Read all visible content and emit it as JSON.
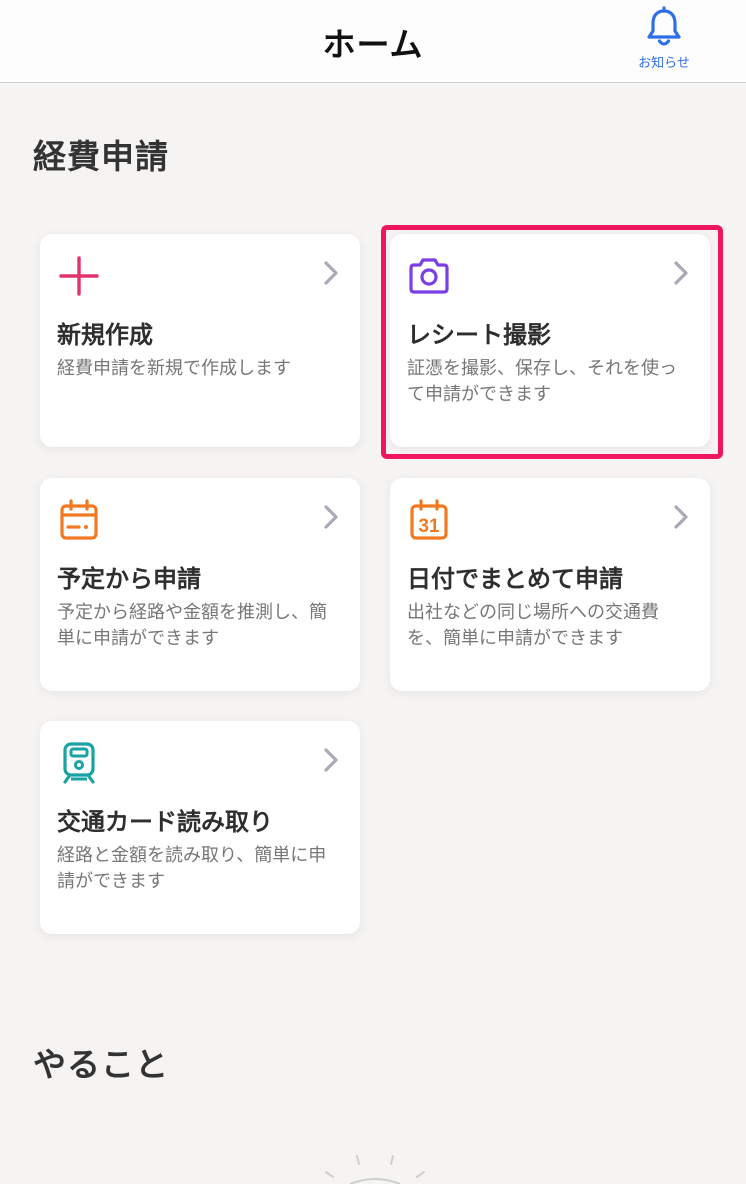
{
  "header": {
    "title": "ホーム",
    "notification_label": "お知らせ",
    "notification_icon": "bell-icon",
    "accent_color": "#2f6fe6"
  },
  "expense_section": {
    "title": "経費申請",
    "cards": [
      {
        "key": "new",
        "title": "新規作成",
        "description": "経費申請を新規で作成します",
        "icon": "plus-icon",
        "icon_color": "#e0336b"
      },
      {
        "key": "receipt",
        "title": "レシート撮影",
        "description": "証憑を撮影、保存し、それを使って申請ができます",
        "icon": "camera-icon",
        "icon_color": "#7a3fe4",
        "highlighted": true,
        "highlight_color": "#f0155f"
      },
      {
        "key": "schedule",
        "title": "予定から申請",
        "description": "予定から経路や金額を推測し、簡単に申請ができます",
        "icon": "calendar-icon",
        "icon_color": "#f07a21"
      },
      {
        "key": "by-date",
        "title": "日付でまとめて申請",
        "description": "出社などの同じ場所への交通費を、簡単に申請ができます",
        "icon": "calendar-31-icon",
        "icon_text": "31",
        "icon_color": "#f07a21"
      },
      {
        "key": "ic-card",
        "title": "交通カード読み取り",
        "description": "経路と金額を読み取り、簡単に申請ができます",
        "icon": "train-icon",
        "icon_color": "#1aa3a3"
      }
    ]
  },
  "todo_section": {
    "title": "やること"
  }
}
